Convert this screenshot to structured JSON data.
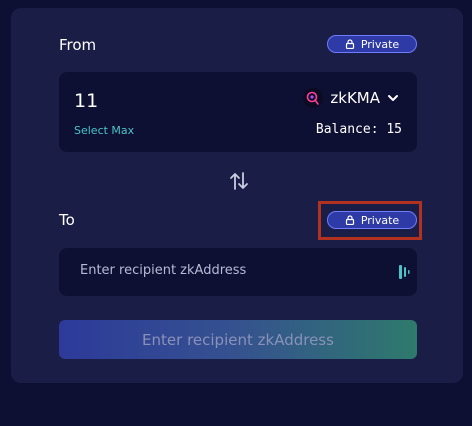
{
  "from": {
    "label": "From",
    "privacy_label": "Private",
    "amount": "11",
    "select_max": "Select Max",
    "token_name": "zkKMA",
    "balance_text": "Balance: 15"
  },
  "to": {
    "label": "To",
    "privacy_label": "Private",
    "recipient_placeholder": "Enter recipient zkAddress"
  },
  "submit_label": "Enter recipient zkAddress",
  "colors": {
    "background": "#0e1033",
    "card": "#1a1d45",
    "pill": "#2e3aa6",
    "accent_teal": "#4bc3c8",
    "highlight": "#b3311f"
  },
  "icons": [
    "lock-icon",
    "token-logo-icon",
    "chevron-down-icon",
    "swap-arrows-icon",
    "scan-icon"
  ]
}
